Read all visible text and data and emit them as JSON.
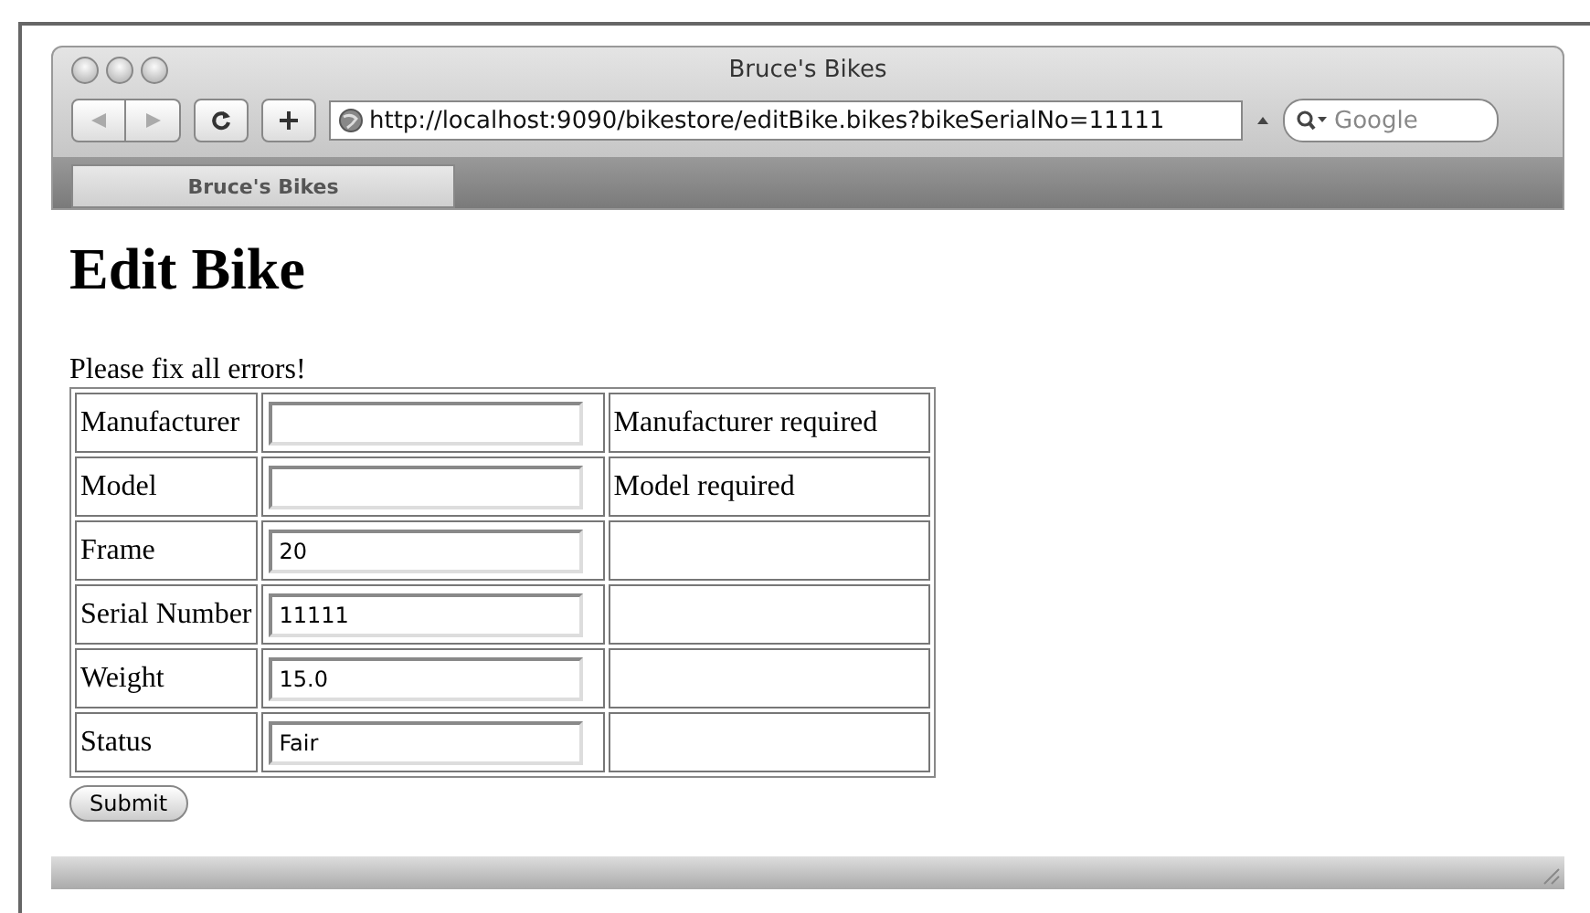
{
  "window": {
    "title": "Bruce's Bikes"
  },
  "toolbar": {
    "url": "http://localhost:9090/bikestore/editBike.bikes?bikeSerialNo=11111",
    "search_placeholder": "Google"
  },
  "tabs": [
    {
      "label": "Bruce's Bikes",
      "selected": true
    }
  ],
  "page": {
    "heading": "Edit Bike",
    "message": "Please fix all errors!",
    "submit": "Submit"
  },
  "fields": [
    {
      "label": "Manufacturer",
      "error": "Manufacturer required"
    },
    {
      "label": "Model",
      "error": "Model required"
    },
    {
      "label": "Frame",
      "value": "20"
    },
    {
      "label": "Serial Number",
      "value": "11111"
    },
    {
      "label": "Weight",
      "value": "15.0"
    },
    {
      "label": "Status",
      "value": "Fair"
    }
  ]
}
